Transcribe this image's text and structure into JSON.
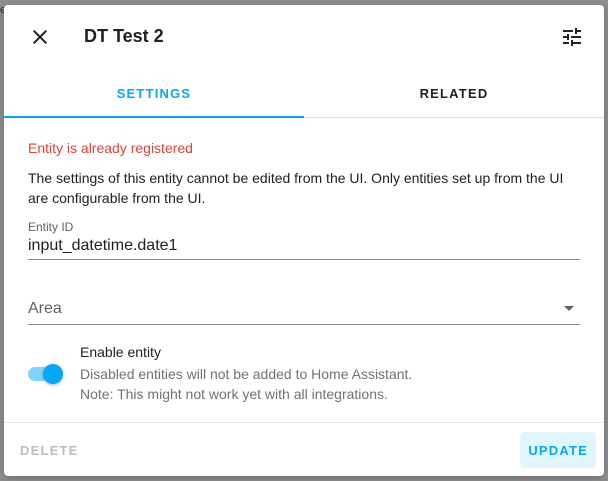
{
  "background": {
    "edge_char": "e"
  },
  "dialog": {
    "title": "DT Test 2",
    "close_icon": "close-icon",
    "settings_icon": "tune-icon"
  },
  "tabs": [
    {
      "label": "SETTINGS",
      "active": true
    },
    {
      "label": "RELATED",
      "active": false
    }
  ],
  "content": {
    "error": "Entity is already registered",
    "description": "The settings of this entity cannot be edited from the UI. Only entities set up from the UI are configurable from the UI.",
    "entity_id": {
      "label": "Entity ID",
      "value": "input_datetime.date1"
    },
    "area": {
      "label": "Area",
      "value": ""
    },
    "enable": {
      "label": "Enable entity",
      "enabled": true,
      "sub1": "Disabled entities will not be added to Home Assistant.",
      "sub2": "Note: This might not work yet with all integrations."
    }
  },
  "footer": {
    "delete_label": "DELETE",
    "update_label": "UPDATE"
  },
  "colors": {
    "accent": "#03a9f4",
    "error": "#db4437"
  }
}
